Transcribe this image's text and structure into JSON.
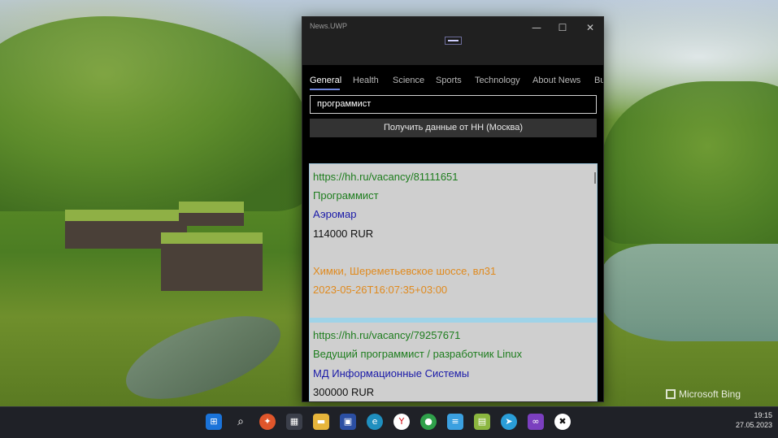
{
  "window": {
    "title": "News.UWP",
    "minimize_glyph": "—",
    "maximize_glyph": "☐",
    "close_glyph": "✕"
  },
  "tabs": [
    {
      "label": "General",
      "active": true
    },
    {
      "label": "Health",
      "active": false
    },
    {
      "label": "Science",
      "active": false
    },
    {
      "label": "Sports",
      "active": false
    },
    {
      "label": "Technology",
      "active": false
    },
    {
      "label": "About News",
      "active": false
    },
    {
      "label": "Bus",
      "active": false
    }
  ],
  "search": {
    "value": "программист"
  },
  "fetch_button": {
    "label": "Получить данные от НН (Москва)"
  },
  "vacancies": [
    {
      "url": "https://hh.ru/vacancy/81111651",
      "name": "Программист",
      "employer": "Аэромар",
      "salary": "114000 RUR",
      "address": "Химки, Шереметьевское шоссе, вл31",
      "date": "2023-05-26T16:07:35+03:00"
    },
    {
      "url": "https://hh.ru/vacancy/79257671",
      "name": "Ведущий программист / разработчик Linux",
      "employer": "МД Информационные Системы",
      "salary": "300000 RUR"
    }
  ],
  "desktop": {
    "watermark": "Microsoft Bing"
  },
  "taskbar": {
    "icons": [
      "windows-start-icon",
      "search-icon",
      "app-orange-icon",
      "store-icon",
      "file-explorer-icon",
      "save-app-icon",
      "edge-icon",
      "yandex-browser-icon",
      "chrome-icon",
      "notepad-icon",
      "chart-app-icon",
      "telegram-icon",
      "visual-studio-icon",
      "app-x-icon"
    ],
    "time": "19:15",
    "date": "27.05.2023"
  },
  "colors": {
    "accent": "#6e84d9",
    "url_green": "#1e7d1e",
    "employer_blue": "#1a1aa8",
    "address_orange": "#e08a1e",
    "card_separator": "#9fd3e8"
  }
}
